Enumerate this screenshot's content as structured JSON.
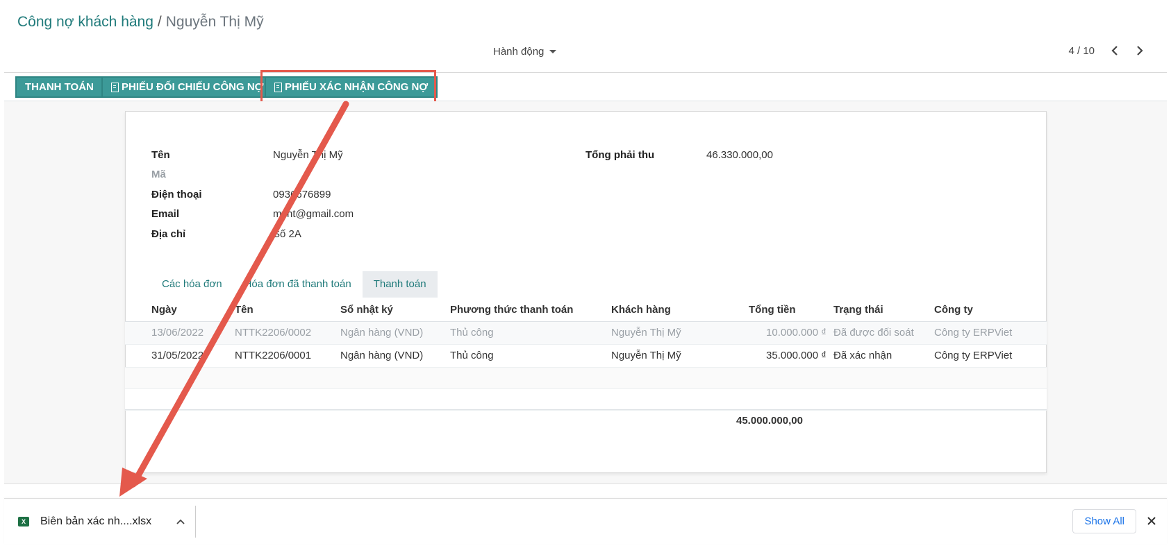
{
  "breadcrumb": {
    "parent": "Công nợ khách hàng",
    "separator": "/",
    "current": "Nguyễn Thị Mỹ"
  },
  "action_menu": {
    "label": "Hành động"
  },
  "pager": {
    "value": "4 / 10"
  },
  "buttons": {
    "payment": "THANH TOÁN",
    "reconcile_form": "PHIẾU ĐỐI CHIẾU CÔNG NỢ",
    "confirm_form": "PHIẾU XÁC NHẬN CÔNG NỢ"
  },
  "form": {
    "name_label": "Tên",
    "name_value": "Nguyễn Thị Mỹ",
    "code_label": "Mã",
    "phone_label": "Điện thoại",
    "phone_value": "0936676899",
    "email_label": "Email",
    "email_value": "mynt@gmail.com",
    "address_label": "Địa chỉ",
    "address_value": "Số 2A",
    "total_receivable_label": "Tổng phải thu",
    "total_receivable_value": "46.330.000,00"
  },
  "tabs": [
    {
      "label": "Các hóa đơn",
      "active": false
    },
    {
      "label": "Hóa đơn đã thanh toán",
      "active": false
    },
    {
      "label": "Thanh toán",
      "active": true
    }
  ],
  "table": {
    "headers": [
      "Ngày",
      "Tên",
      "Sổ nhật ký",
      "Phương thức thanh toán",
      "Khách hàng",
      "Tổng tiền",
      "Trạng thái",
      "Công ty"
    ],
    "rows": [
      [
        "13/06/2022",
        "NTTK2206/0002",
        "Ngân hàng (VND)",
        "Thủ công",
        "Nguyễn Thị Mỹ",
        "10.000.000 ₫",
        "Đã được đối soát",
        "Công ty ERPViet"
      ],
      [
        "31/05/2022",
        "NTTK2206/0001",
        "Ngân hàng (VND)",
        "Thủ công",
        "Nguyễn Thị Mỹ",
        "35.000.000 ₫",
        "Đã xác nhận",
        "Công ty ERPViet"
      ]
    ],
    "total": "45.000.000,00"
  },
  "download_bar": {
    "file_name": "Biên bản xác nh....xlsx",
    "show_all": "Show All"
  },
  "colors": {
    "accent": "#3c9a98",
    "highlight": "#e4594c",
    "link": "#1f7a7a"
  }
}
